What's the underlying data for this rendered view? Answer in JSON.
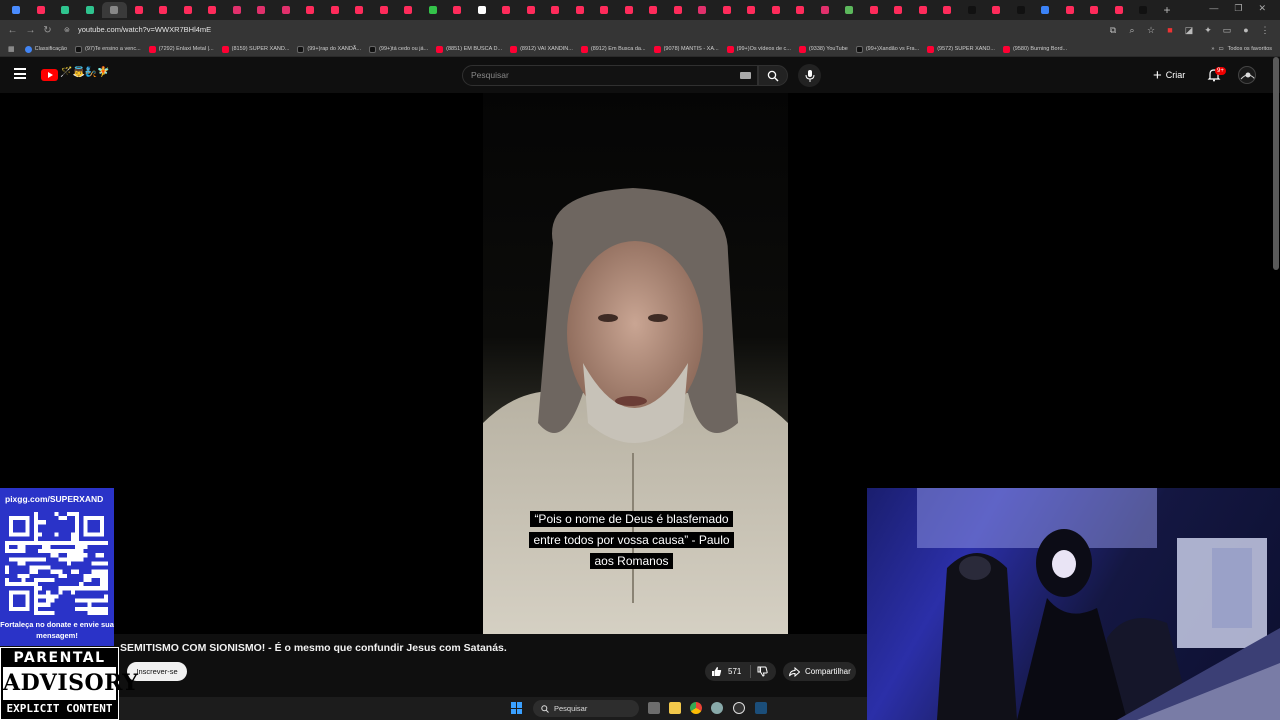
{
  "browser": {
    "tab_count": 47,
    "url": "youtube.com/watch?v=WWXR7BHl4mE",
    "bookmarks": [
      {
        "label": "Classificação",
        "icon": "globe-icon"
      },
      {
        "label": "(97)Te ensino a venc...",
        "icon": "tiktok-icon"
      },
      {
        "label": "(7292) Enlaxi Metal |...",
        "icon": "youtube-icon"
      },
      {
        "label": "(8159) SUPER XAND...",
        "icon": "youtube-icon"
      },
      {
        "label": "(99+)rap do XANDÃ...",
        "icon": "tiktok-icon"
      },
      {
        "label": "(99+)tá cedo ou já...",
        "icon": "tiktok-icon"
      },
      {
        "label": "(8851) EM BUSCA D...",
        "icon": "youtube-icon"
      },
      {
        "label": "(8912) VAI XANDIN...",
        "icon": "youtube-icon"
      },
      {
        "label": "(8912) Em Busca da...",
        "icon": "youtube-icon"
      },
      {
        "label": "(9078) MANTIS - XA...",
        "icon": "youtube-icon"
      },
      {
        "label": "(99+)Os vídeos de c...",
        "icon": "youtube-icon"
      },
      {
        "label": "(9338) YouTube",
        "icon": "youtube-icon"
      },
      {
        "label": "(99+)Xandão vs Fra...",
        "icon": "tiktok-icon"
      },
      {
        "label": "(9572) SUPER XAND...",
        "icon": "youtube-icon"
      },
      {
        "label": "(9580) Burning Bord...",
        "icon": "youtube-icon"
      }
    ],
    "bookmarks_more": "»",
    "all_favorites": "Todos os favoritos"
  },
  "youtube": {
    "search_placeholder": "Pesquisar",
    "create_label": "Criar",
    "notification_badge": "9+",
    "logo_emoji": "🪄👼🧞🧚"
  },
  "video": {
    "caption": "“Pois o nome de Deus é blasfemado entre todos por vossa causa” - Paulo aos Romanos",
    "title": "SEMITISMO COM SIONISMO! - É o mesmo que confundir Jesus com Satanás.",
    "subscribe_label": "Inscrever-se",
    "like_count": "571",
    "share_label": "Compartilhar"
  },
  "overlay": {
    "donate_url": "pixgg.com/SUPERXAND",
    "donate_message": "Fortaleça no donate e envie sua mensagem!",
    "advisory_top": "PARENTAL",
    "advisory_mid": "ADVISORY",
    "advisory_bottom": "EXPLICIT CONTENT"
  },
  "taskbar": {
    "search_label": "Pesquisar"
  }
}
